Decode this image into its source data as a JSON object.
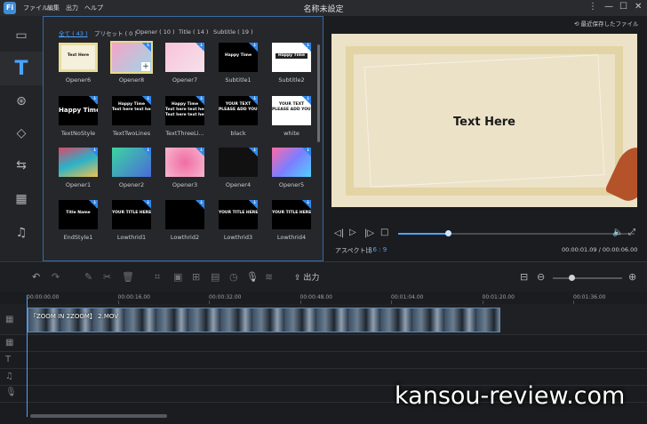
{
  "app": {
    "logo": "Fi",
    "title": "名称未設定",
    "menu": [
      "ファイル",
      "編集",
      "出力",
      "ヘルプ"
    ]
  },
  "sidebar": {
    "icons": [
      "media-icon",
      "text-icon",
      "filter-icon",
      "overlay-icon",
      "transition-icon",
      "element-icon",
      "music-icon"
    ]
  },
  "library": {
    "tabs": [
      "全て ( 43 )",
      "プリセット ( 0 )",
      "Opener ( 10 )",
      "Title ( 14 )",
      "Subtitle ( 19 )"
    ],
    "items": [
      {
        "caption": "Opener6",
        "thumb": "Text Here",
        "style": "frame"
      },
      {
        "caption": "Opener8",
        "thumb": "",
        "style": "pink-sel"
      },
      {
        "caption": "Opener7",
        "thumb": "",
        "style": "pink"
      },
      {
        "caption": "Subtitle1",
        "thumb": "Happy Time",
        "style": "black"
      },
      {
        "caption": "Subtitle2",
        "thumb": "Happy Time",
        "style": "white-bar"
      },
      {
        "caption": "TextNoStyle",
        "thumb": "Happy Time",
        "style": "black-big"
      },
      {
        "caption": "TextTwoLines",
        "thumb": "Happy Time\nText here text here",
        "style": "black"
      },
      {
        "caption": "TextThreeLi...",
        "thumb": "Happy Time\nText here text here\nText here text here",
        "style": "black"
      },
      {
        "caption": "black",
        "thumb": "YOUR TEXT\nPLEASE ADD YOUR TEXT",
        "style": "black"
      },
      {
        "caption": "white",
        "thumb": "YOUR TEXT\nPLEASE ADD YOUR TEXT",
        "style": "white"
      },
      {
        "caption": "Opener1",
        "thumb": "",
        "style": "colorful"
      },
      {
        "caption": "Opener2",
        "thumb": "",
        "style": "green"
      },
      {
        "caption": "Opener3",
        "thumb": "",
        "style": "pink2"
      },
      {
        "caption": "Opener4",
        "thumb": "",
        "style": "black-gold"
      },
      {
        "caption": "Opener5",
        "thumb": "",
        "style": "gradient"
      },
      {
        "caption": "EndStyle1",
        "thumb": "Title Name",
        "style": "black"
      },
      {
        "caption": "Lowthrid1",
        "thumb": "YOUR TITLE HERE",
        "style": "black"
      },
      {
        "caption": "Lowthrid2",
        "thumb": "",
        "style": "black"
      },
      {
        "caption": "Lowthrid3",
        "thumb": "YOUR TITLE HERE",
        "style": "black"
      },
      {
        "caption": "Lowthrid4",
        "thumb": "YOUR TITLE HERE",
        "style": "black"
      }
    ]
  },
  "preview": {
    "recent": "最近保存したファイル",
    "text": "Text Here",
    "aspect_label": "アスペクト比",
    "aspect_value": "16 : 9",
    "time": "00:00:01.09 / 00:00:06.00",
    "progress": 0.21
  },
  "toolbar": {
    "export": "出力"
  },
  "timeline": {
    "ticks": [
      "00:00:00.00",
      "00:00:16.00",
      "00:00:32.00",
      "00:00:48.00",
      "00:01:04.00",
      "00:01:20.00",
      "00:01:36.00"
    ],
    "clip_label": "「ZOOM IN 2ZOOM】 2.MOV"
  },
  "watermark": "kansou-review.com"
}
